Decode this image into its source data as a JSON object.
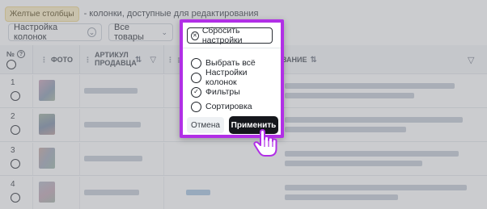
{
  "hint": {
    "tag": "Желтые столбцы",
    "text": "- колонки, доступные для редактирования"
  },
  "filters": {
    "columns_settings": "Настройка колонок",
    "goods": "Все товары"
  },
  "table": {
    "headers": {
      "number": "№",
      "photo": "ФОТО",
      "article": "АРТИКУЛ ПРОДАВЦА",
      "name": "ВАНИЕ"
    },
    "rows": [
      "1",
      "2",
      "3",
      "4"
    ]
  },
  "popup": {
    "reset_label": "Сбросить настройки",
    "options": [
      {
        "label": "Выбрать всё",
        "checked": false
      },
      {
        "label": "Настройки колонок",
        "checked": false
      },
      {
        "label": "Фильтры",
        "checked": true
      },
      {
        "label": "Сортировка",
        "checked": false
      }
    ],
    "cancel_label": "Отмена",
    "apply_label": "Применить"
  },
  "colors": {
    "highlight": "#b12fe6",
    "apply_bg": "#15171c",
    "tag_bg": "#fbeec4"
  },
  "icons": {
    "help": "question-circle-icon",
    "sort": "sort-arrows-icon",
    "filter": "funnel-icon",
    "reset": "close-circle-icon",
    "cursor": "hand-pointer-icon"
  }
}
